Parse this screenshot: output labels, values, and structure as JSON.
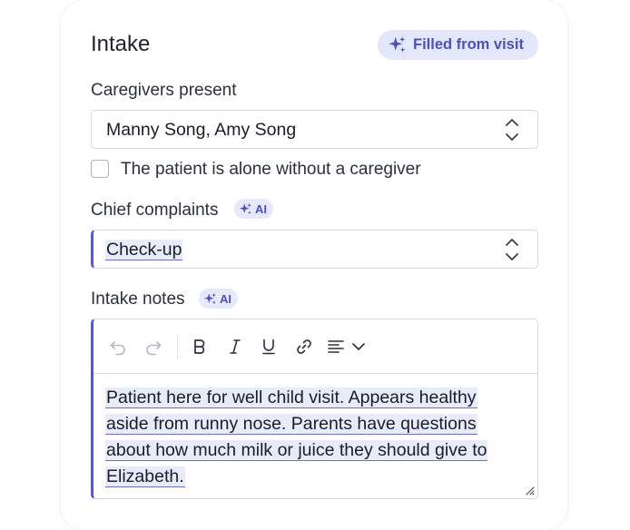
{
  "form": {
    "title": "Intake",
    "filled_badge": "Filled from visit",
    "caregivers": {
      "label": "Caregivers present",
      "value": "Manny Song, Amy Song"
    },
    "alone_checkbox": {
      "label": "The patient is alone without a caregiver",
      "checked": false
    },
    "chief_complaints": {
      "label": "Chief complaints",
      "ai_badge": "AI",
      "value": "Check-up"
    },
    "intake_notes": {
      "label": "Intake notes",
      "ai_badge": "AI",
      "lines": [
        "Patient here for well child visit. Appears healthy",
        "aside from runny nose. Parents have questions",
        "about how much milk or juice they should give to",
        "Elizabeth."
      ]
    }
  },
  "toolbar_icons": [
    "undo-icon",
    "redo-icon",
    "bold-icon",
    "italic-icon",
    "underline-icon",
    "link-icon",
    "align-icon",
    "chevron-down-icon"
  ],
  "colors": {
    "accent": "#5a57d1",
    "badge_bg": "#e3e7fb",
    "badge_text": "#4c4fc4",
    "ai_highlight": "#e8ebfa",
    "border": "#d6d9e0"
  }
}
